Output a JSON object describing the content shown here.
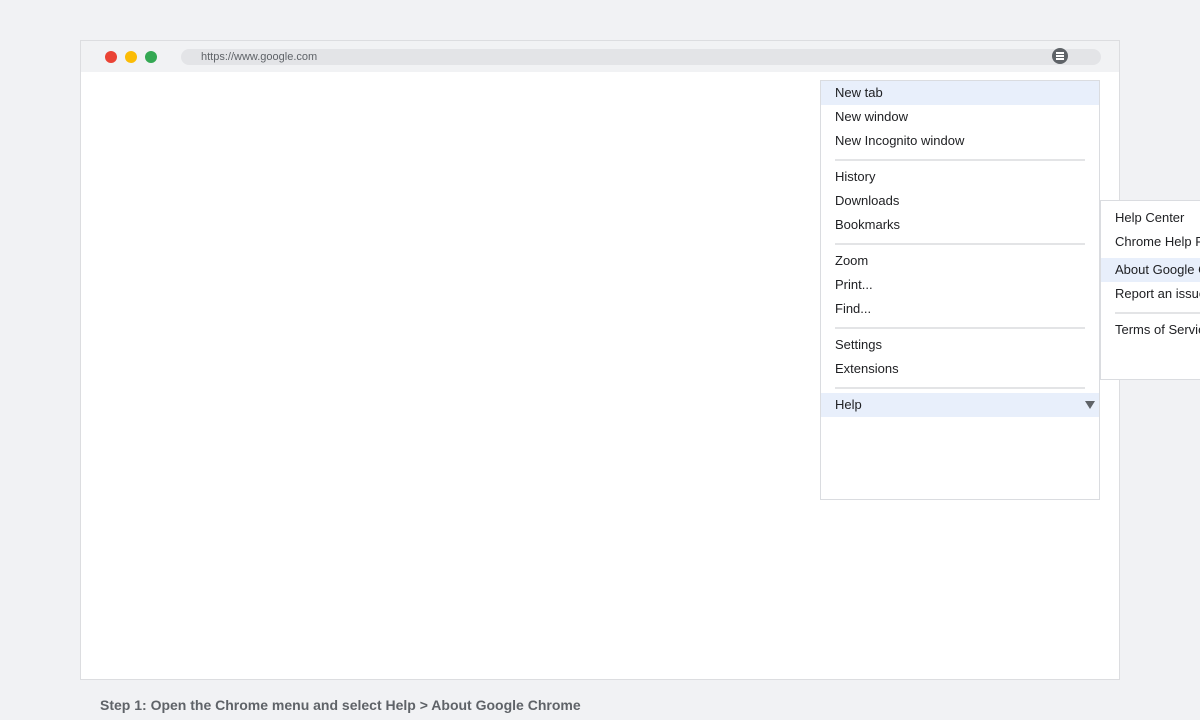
{
  "window_controls": {
    "close": "close",
    "minimize": "minimize",
    "maximize": "maximize",
    "close_color": "#ea4335",
    "minimize_color": "#fbbc05",
    "maximize_color": "#34a853"
  },
  "address_bar": {
    "url": "https://www.google.com"
  },
  "toolbar": {
    "menu_icon": "menu-icon"
  },
  "menu": {
    "items": [
      {
        "label": "New tab",
        "highlighted": true
      },
      {
        "label": "New window"
      },
      {
        "label": "New Incognito window"
      },
      {
        "label": "History"
      },
      {
        "label": "Downloads"
      },
      {
        "label": "Bookmarks"
      },
      {
        "label": "Zoom"
      },
      {
        "label": "Print..."
      },
      {
        "label": "Find..."
      },
      {
        "label": "Settings"
      },
      {
        "label": "Extensions"
      },
      {
        "label": "Help",
        "highlighted": true,
        "has_submenu": true
      }
    ],
    "submenu_indicator_icon": "triangle-down-icon",
    "highlight_color": "#e8effb"
  },
  "help_submenu": {
    "items": [
      {
        "label": "Help Center"
      },
      {
        "label": "Chrome Help Forum"
      },
      {
        "label": "About Google Chrome",
        "highlighted": true
      },
      {
        "label": "Report an issue"
      },
      {
        "label": "Terms of Service"
      }
    ]
  },
  "caption": {
    "text": "Step 1: Open the Chrome menu and select Help > About Google Chrome"
  }
}
